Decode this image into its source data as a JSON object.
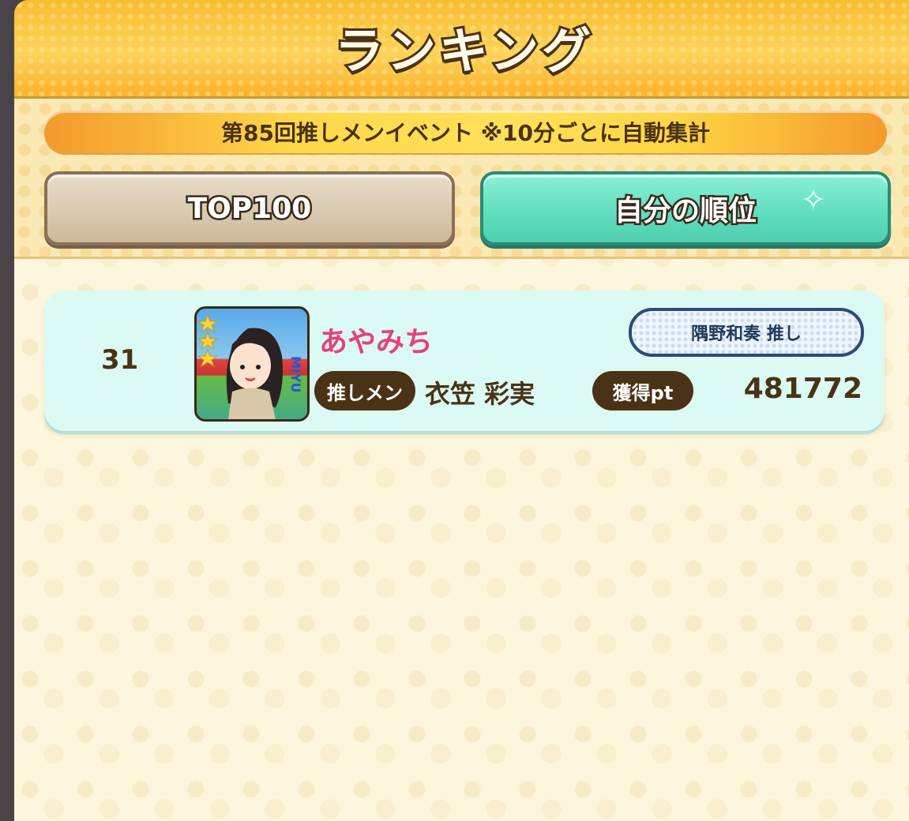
{
  "header": {
    "title": "ランキング"
  },
  "event": {
    "banner_text": "第85回推しメンイベント ※10分ごとに自動集計"
  },
  "tabs": {
    "top100_label": "TOP100",
    "self_label": "自分の順位"
  },
  "entry": {
    "rank": "31",
    "user_name": "あやみち",
    "fan_badge": "隅野和奏 推し",
    "oshi_label": "推しメン",
    "member_name": "衣笠 彩実",
    "points_label": "獲得pt",
    "points": "481772",
    "avatar_text": "MIYU"
  },
  "colors": {
    "accent_teal": "#5fdcbd",
    "user_name_pink": "#e8407a",
    "brown": "#4a3216",
    "gold": "#fbd257"
  }
}
